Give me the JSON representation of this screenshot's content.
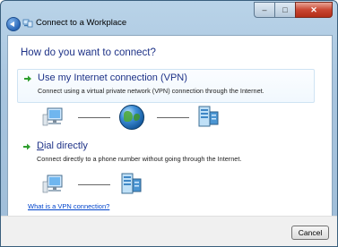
{
  "window": {
    "title": "Connect to a Workplace",
    "controls": {
      "minimize": "–",
      "maximize": "□",
      "close": "✕"
    }
  },
  "heading": "How do you want to connect?",
  "options": [
    {
      "title": "Use my Internet connection (VPN)",
      "description": "Connect using a virtual private network (VPN) connection through the Internet.",
      "icons": [
        "computer-icon",
        "globe-icon",
        "server-icon"
      ]
    },
    {
      "title_prefix": "D",
      "title_rest": "ial directly",
      "description": "Connect directly to a phone number without going through the Internet.",
      "icons": [
        "computer-icon",
        "server-icon"
      ]
    }
  ],
  "help_link": "What is a VPN connection?",
  "buttons": {
    "cancel": "Cancel"
  },
  "colors": {
    "heading": "#1e3287",
    "link": "#0044cc",
    "arrow": "#2e9e2e"
  }
}
